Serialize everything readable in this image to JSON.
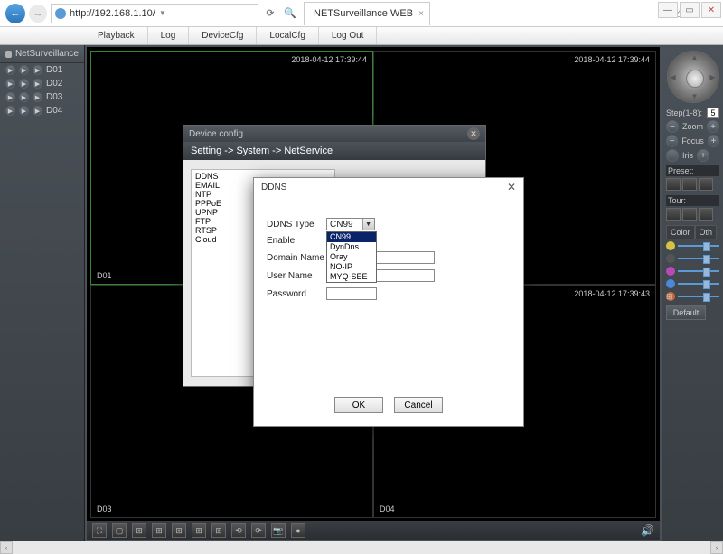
{
  "browser": {
    "url": "http://192.168.1.10/",
    "tab_title": "NETSurveillance WEB"
  },
  "nav": {
    "playback": "Playback",
    "log": "Log",
    "devicecfg": "DeviceCfg",
    "localcfg": "LocalCfg",
    "logout": "Log Out"
  },
  "sidebar": {
    "title": "NetSurveillance",
    "channels": [
      "D01",
      "D02",
      "D03",
      "D04"
    ]
  },
  "view": {
    "ts1": "2018-04-12 17:39:44",
    "ts2": "2018-04-12 17:39:44",
    "ts4": "2018-04-12 17:39:43",
    "lbl1": "D01",
    "lbl3": "D03",
    "lbl4": "D04"
  },
  "ptz": {
    "step_label": "Step(1-8):",
    "step_val": "5",
    "zoom": "Zoom",
    "focus": "Focus",
    "iris": "Iris",
    "preset": "Preset:",
    "tour": "Tour:",
    "color_tab": "Color",
    "other_tab": "Oth",
    "default": "Default"
  },
  "devcfg": {
    "title": "Device config",
    "breadcrumb": "Setting -> System -> NetService",
    "services": [
      "DDNS",
      "EMAIL",
      "NTP",
      "PPPoE",
      "UPNP",
      "FTP",
      "RTSP",
      "Cloud"
    ]
  },
  "ddns": {
    "title": "DDNS",
    "type_label": "DDNS Type",
    "type_value": "CN99",
    "options": [
      "CN99",
      "DynDns",
      "Oray",
      "NO-IP",
      "MYQ-SEE"
    ],
    "enable_label": "Enable",
    "domain_label": "Domain Name",
    "user_label": "User Name",
    "pass_label": "Password",
    "ok": "OK",
    "cancel": "Cancel"
  }
}
